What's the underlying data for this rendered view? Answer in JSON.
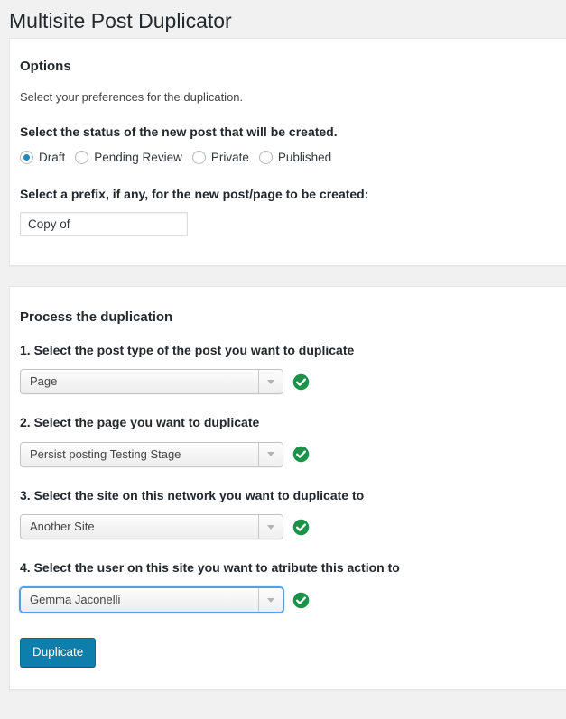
{
  "page": {
    "title": "Multisite Post Duplicator"
  },
  "options_panel": {
    "heading": "Options",
    "description": "Select your preferences for the duplication.",
    "status_label": "Select the status of the new post that will be created.",
    "status_options": [
      {
        "label": "Draft",
        "checked": true
      },
      {
        "label": "Pending Review",
        "checked": false
      },
      {
        "label": "Private",
        "checked": false
      },
      {
        "label": "Published",
        "checked": false
      }
    ],
    "prefix_label": "Select a prefix, if any, for the new post/page to be created:",
    "prefix_value": "Copy of",
    "prefix_placeholder": ""
  },
  "process_panel": {
    "heading": "Process the duplication",
    "steps": [
      {
        "label": "1. Select the post type of the post you want to duplicate",
        "value": "Page",
        "valid": true,
        "focused": false
      },
      {
        "label": "2. Select the page you want to duplicate",
        "value": "Persist posting Testing Stage",
        "valid": true,
        "focused": false
      },
      {
        "label": "3. Select the site on this network you want to duplicate to",
        "value": "Another Site",
        "valid": true,
        "focused": false
      },
      {
        "label": "4. Select the user on this site you want to atribute this action to",
        "value": "Gemma Jaconelli",
        "valid": true,
        "focused": true
      }
    ],
    "submit_label": "Duplicate"
  },
  "colors": {
    "accent": "#0e7fac",
    "valid": "#1a9247",
    "radio_selected": "#1e8cbe",
    "page_bg": "#f1f1f1",
    "focus_ring": "#5b9dd9"
  }
}
